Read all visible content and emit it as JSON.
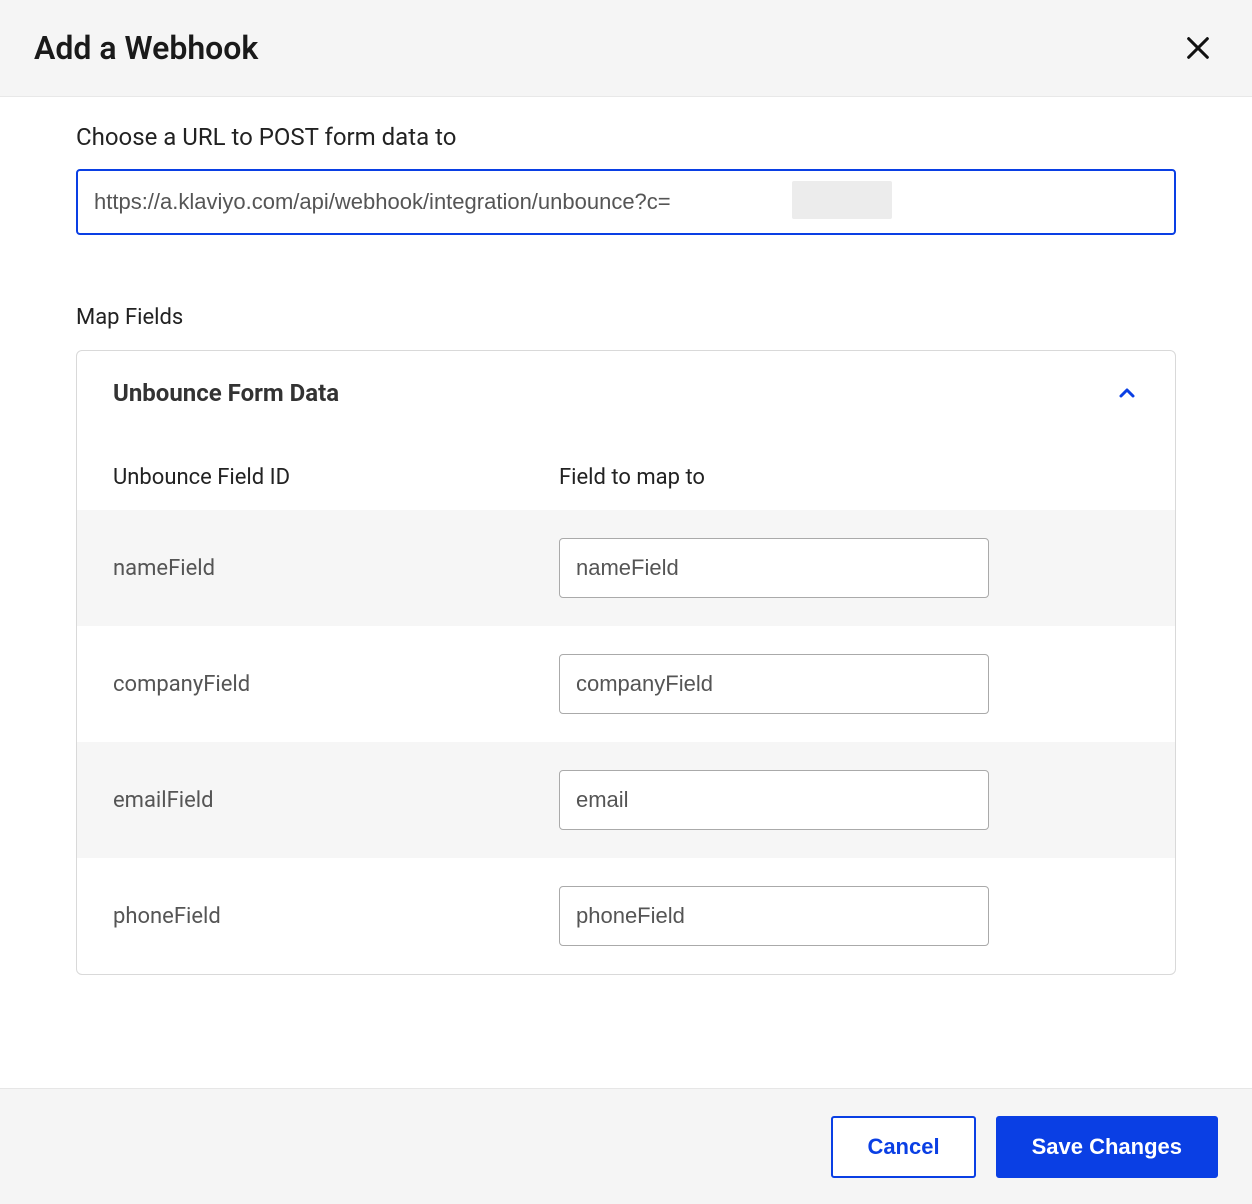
{
  "dialog": {
    "title": "Add a Webhook",
    "url_label": "Choose a URL to POST form data to",
    "url_value": "https://a.klaviyo.com/api/webhook/integration/unbounce?c=",
    "map_fields_label": "Map Fields",
    "panel_title": "Unbounce Form Data",
    "columns": {
      "left": "Unbounce Field ID",
      "right": "Field to map to"
    },
    "rows": [
      {
        "id": "nameField",
        "map": "nameField"
      },
      {
        "id": "companyField",
        "map": "companyField"
      },
      {
        "id": "emailField",
        "map": "email"
      },
      {
        "id": "phoneField",
        "map": "phoneField"
      }
    ],
    "buttons": {
      "cancel": "Cancel",
      "save": "Save Changes"
    }
  }
}
